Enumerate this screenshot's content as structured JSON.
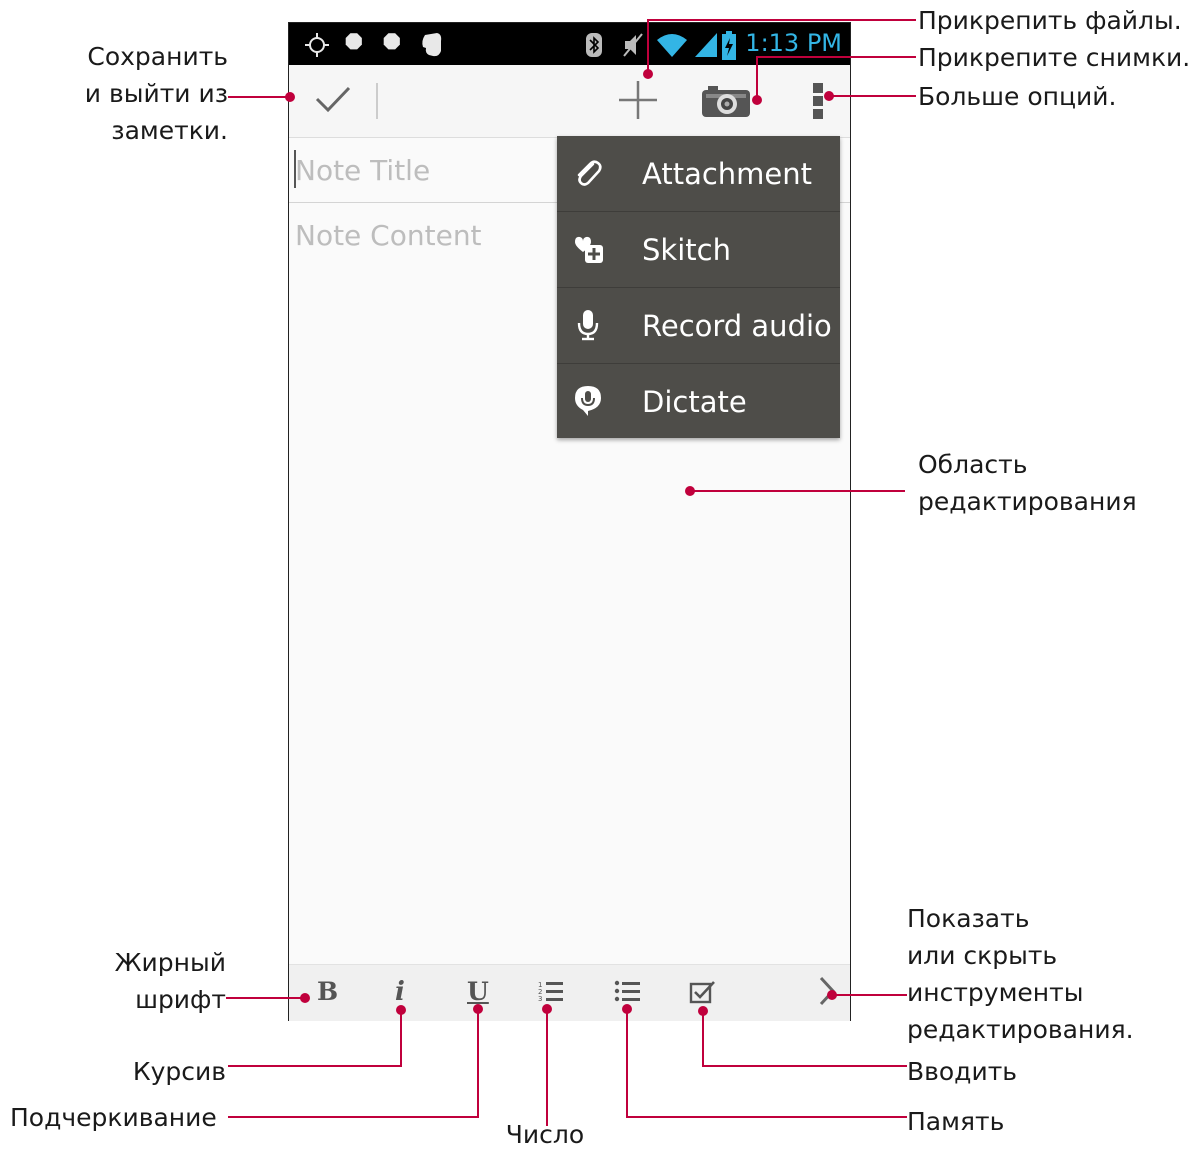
{
  "status_bar": {
    "time": "1:13 PM",
    "left_icons": [
      "gps-icon",
      "usb-icon",
      "usb-icon",
      "evernote-icon"
    ],
    "right_icons": [
      "bluetooth-icon",
      "mute-icon",
      "wifi-icon",
      "signal-icon",
      "battery-charging-icon"
    ]
  },
  "action_bar": {
    "icons": [
      "check-icon",
      "plus-icon",
      "camera-icon",
      "overflow-menu-icon"
    ]
  },
  "note": {
    "title_placeholder": "Note Title",
    "content_placeholder": "Note Content"
  },
  "menu": {
    "items": [
      {
        "label": "Attachment",
        "icon": "paperclip-icon"
      },
      {
        "label": "Skitch",
        "icon": "skitch-icon"
      },
      {
        "label": "Record audio",
        "icon": "microphone-icon"
      },
      {
        "label": "Dictate",
        "icon": "dictate-icon"
      }
    ]
  },
  "toolbar": {
    "bold": "B",
    "italic": "i",
    "underline": "U",
    "icons": [
      "numbered-list-icon",
      "bullet-list-icon",
      "checkbox-icon",
      "chevron-right-icon"
    ]
  },
  "callouts": {
    "save_exit": [
      "Сохранить",
      "и выйти из",
      "заметки."
    ],
    "attach_files": "Прикрепить файлы.",
    "attach_photos": "Прикрепите снимки.",
    "more_options": "Больше опций.",
    "edit_area": [
      "Область",
      "редактирования"
    ],
    "bold": [
      "Жирный",
      "шрифт"
    ],
    "italic": "Курсив",
    "underline": "Подчеркивание",
    "number": "Число",
    "show_hide": [
      "Показать",
      "или скрыть",
      "инструменты",
      "редактирования."
    ],
    "enter": "Вводить",
    "memory": "Память"
  },
  "colors": {
    "accent_line": "#c0003c",
    "menu_bg": "#4e4d49",
    "time_color": "#33b5e5"
  }
}
